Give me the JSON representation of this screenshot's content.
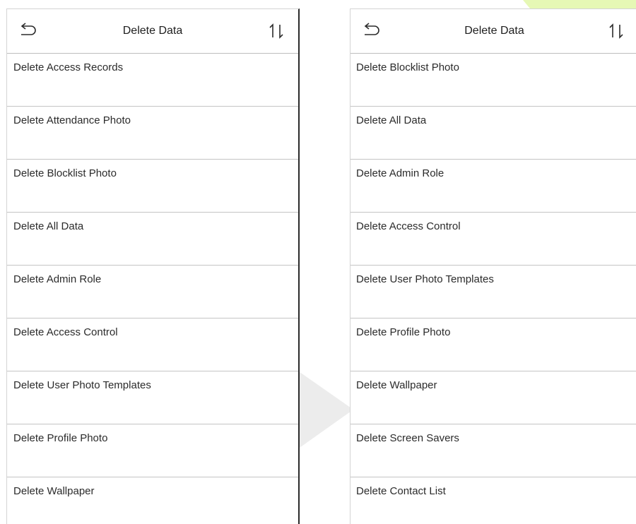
{
  "colors": {
    "watermark_green": "#c8f05a",
    "watermark_gray": "#d9d9d9",
    "divider": "#c4c4c4",
    "text": "#2b2b2b"
  },
  "left_screen": {
    "header": {
      "back_icon": "back-arrow-icon",
      "title": "Delete Data",
      "sort_icon": "sort-icon"
    },
    "items": [
      {
        "label": "Delete Access Records"
      },
      {
        "label": "Delete Attendance Photo"
      },
      {
        "label": "Delete Blocklist Photo"
      },
      {
        "label": "Delete All Data"
      },
      {
        "label": "Delete Admin Role"
      },
      {
        "label": "Delete Access Control"
      },
      {
        "label": "Delete User Photo Templates"
      },
      {
        "label": "Delete Profile Photo"
      },
      {
        "label": "Delete Wallpaper"
      }
    ]
  },
  "right_screen": {
    "header": {
      "back_icon": "back-arrow-icon",
      "title": "Delete Data",
      "sort_icon": "sort-icon"
    },
    "items": [
      {
        "label": "Delete Blocklist Photo"
      },
      {
        "label": "Delete All Data"
      },
      {
        "label": "Delete Admin Role"
      },
      {
        "label": "Delete Access Control"
      },
      {
        "label": "Delete User Photo Templates"
      },
      {
        "label": "Delete Profile Photo"
      },
      {
        "label": "Delete Wallpaper"
      },
      {
        "label": "Delete Screen Savers"
      },
      {
        "label": "Delete Contact List"
      }
    ]
  }
}
